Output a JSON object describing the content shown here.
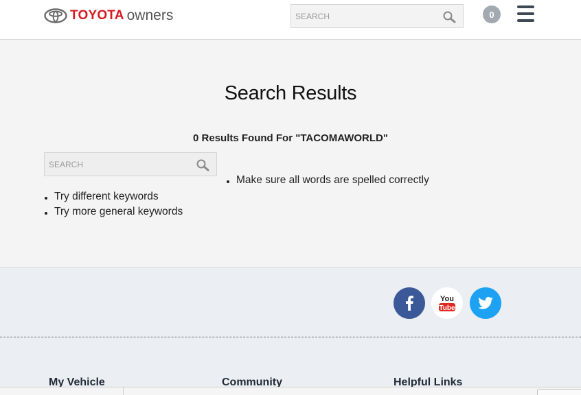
{
  "header": {
    "logo_brand": "TOYOTA",
    "logo_sub": "owners",
    "search_placeholder": "SEARCH",
    "cart_count": "0"
  },
  "main": {
    "title": "Search Results",
    "results_count": "0",
    "results_text": " Results Found For \"TACOMAWORLD\"",
    "search_placeholder": "SEARCH",
    "tips_left": [
      "Try different keywords",
      "Try more general keywords"
    ],
    "tips_right": [
      "Make sure all words are spelled correctly"
    ]
  },
  "footer": {
    "social": [
      {
        "name": "facebook-icon",
        "color": "#3b5998"
      },
      {
        "name": "youtube-icon",
        "color": "#ffffff"
      },
      {
        "name": "twitter-icon",
        "color": "#1da1f2"
      }
    ],
    "columns": [
      "My Vehicle",
      "Community",
      "Helpful Links"
    ]
  },
  "colors": {
    "brand_red": "#d71920",
    "main_bg": "#f4f4f4",
    "footer_bg": "#ebeef2"
  }
}
